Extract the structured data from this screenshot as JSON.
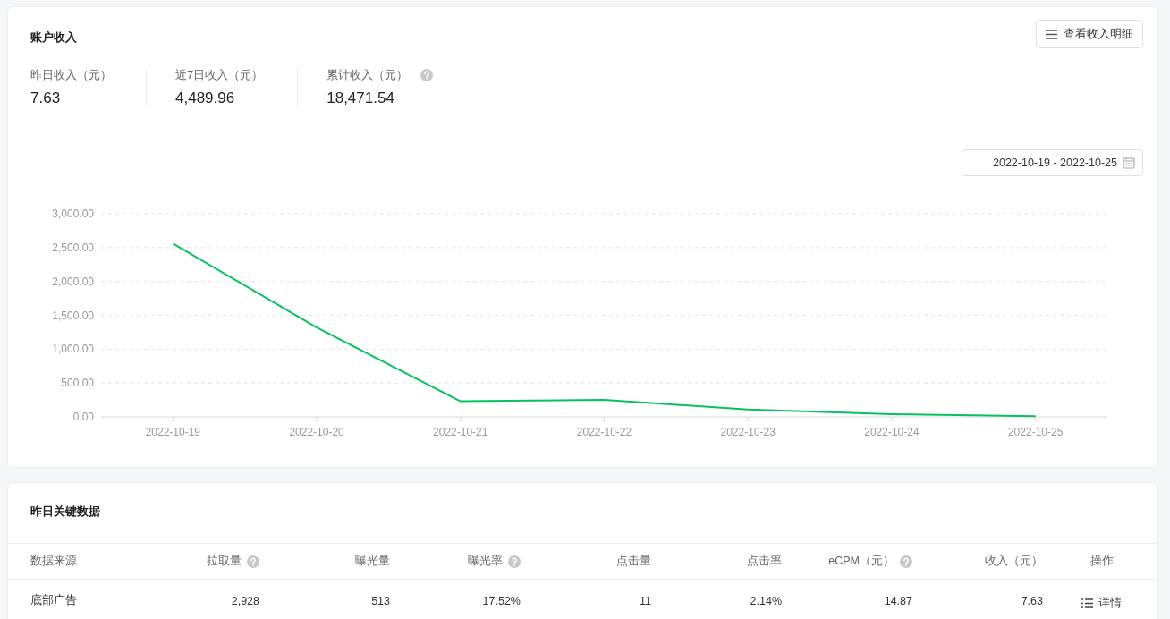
{
  "income": {
    "title": "账户收入",
    "detail_button": {
      "label": "查看收入明细"
    },
    "stats": [
      {
        "label": "昨日收入（元）",
        "value": "7.63",
        "help": false
      },
      {
        "label": "近7日收入（元）",
        "value": "4,489.96",
        "help": false
      },
      {
        "label": "累计收入（元）",
        "value": "18,471.54",
        "help": true
      }
    ],
    "date_range": {
      "value": "2022-10-19 - 2022-10-25"
    },
    "chart_data": {
      "type": "line",
      "categories": [
        "2022-10-19",
        "2022-10-20",
        "2022-10-21",
        "2022-10-22",
        "2022-10-23",
        "2022-10-24",
        "2022-10-25"
      ],
      "grid": true,
      "series": [
        {
          "color": "#07c160",
          "values": [
            2560,
            1320,
            230,
            250,
            110,
            40,
            10
          ]
        }
      ],
      "ylim": [
        0,
        3000
      ],
      "yticks": [
        {
          "value": 0,
          "label": "0.00"
        },
        {
          "value": 500,
          "label": "500.00"
        },
        {
          "value": 1000,
          "label": "1,000.00"
        },
        {
          "value": 1500,
          "label": "1,500.00"
        },
        {
          "value": 2000,
          "label": "2,000.00"
        },
        {
          "value": 2500,
          "label": "2,500.00"
        },
        {
          "value": 3000,
          "label": "3,000.00"
        }
      ]
    }
  },
  "key_data": {
    "title": "昨日关键数据",
    "table": {
      "columns": [
        {
          "label": "数据来源",
          "help": false
        },
        {
          "label": "拉取量",
          "help": true
        },
        {
          "label": "曝光量",
          "help": false
        },
        {
          "label": "曝光率",
          "help": true
        },
        {
          "label": "点击量",
          "help": false
        },
        {
          "label": "点击率",
          "help": false
        },
        {
          "label": "eCPM（元）",
          "help": true
        },
        {
          "label": "收入（元）",
          "help": false
        },
        {
          "label": "操作",
          "help": false
        }
      ],
      "rows": [
        {
          "cells": [
            "底部广告",
            "2,928",
            "513",
            "17.52%",
            "11",
            "2.14%",
            "14.87",
            "7.63"
          ],
          "action": {
            "label": "详情"
          }
        }
      ]
    }
  }
}
